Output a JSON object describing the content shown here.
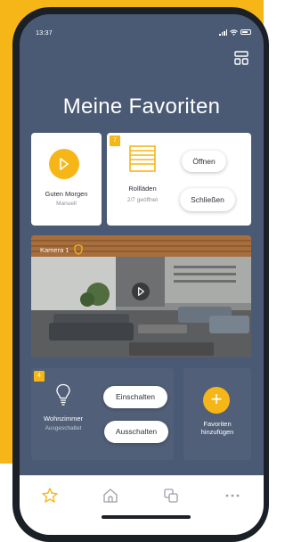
{
  "status_bar": {
    "time": "13:37"
  },
  "header": {
    "title": "Meine Favoriten",
    "layout_icon": "layout-grid-icon"
  },
  "cards": {
    "morning": {
      "label": "Guten Morgen",
      "sublabel": "Manuell",
      "icon": "play-icon"
    },
    "shutters": {
      "badge": "7",
      "label": "Rollläden",
      "sublabel": "2/7 geöffnet",
      "open_label": "Öffnen",
      "close_label": "Schließen",
      "icon": "shutter-icon"
    },
    "camera": {
      "label": "Kamera 1",
      "icon": "shield-icon"
    },
    "light": {
      "badge": "4",
      "label": "Wohnzimmer",
      "sublabel": "Ausgeschaltet",
      "on_label": "Einschalten",
      "off_label": "Ausschalten",
      "icon": "lightbulb-icon"
    },
    "add": {
      "label_line1": "Favoriten",
      "label_line2": "hinzufügen",
      "icon": "plus-icon"
    }
  },
  "tabbar": {
    "items": [
      "star-icon",
      "home-icon",
      "devices-icon",
      "more-icon"
    ]
  },
  "colors": {
    "accent": "#f7b617",
    "screen_bg": "#4a5a75",
    "card_dark": "#515f78"
  }
}
